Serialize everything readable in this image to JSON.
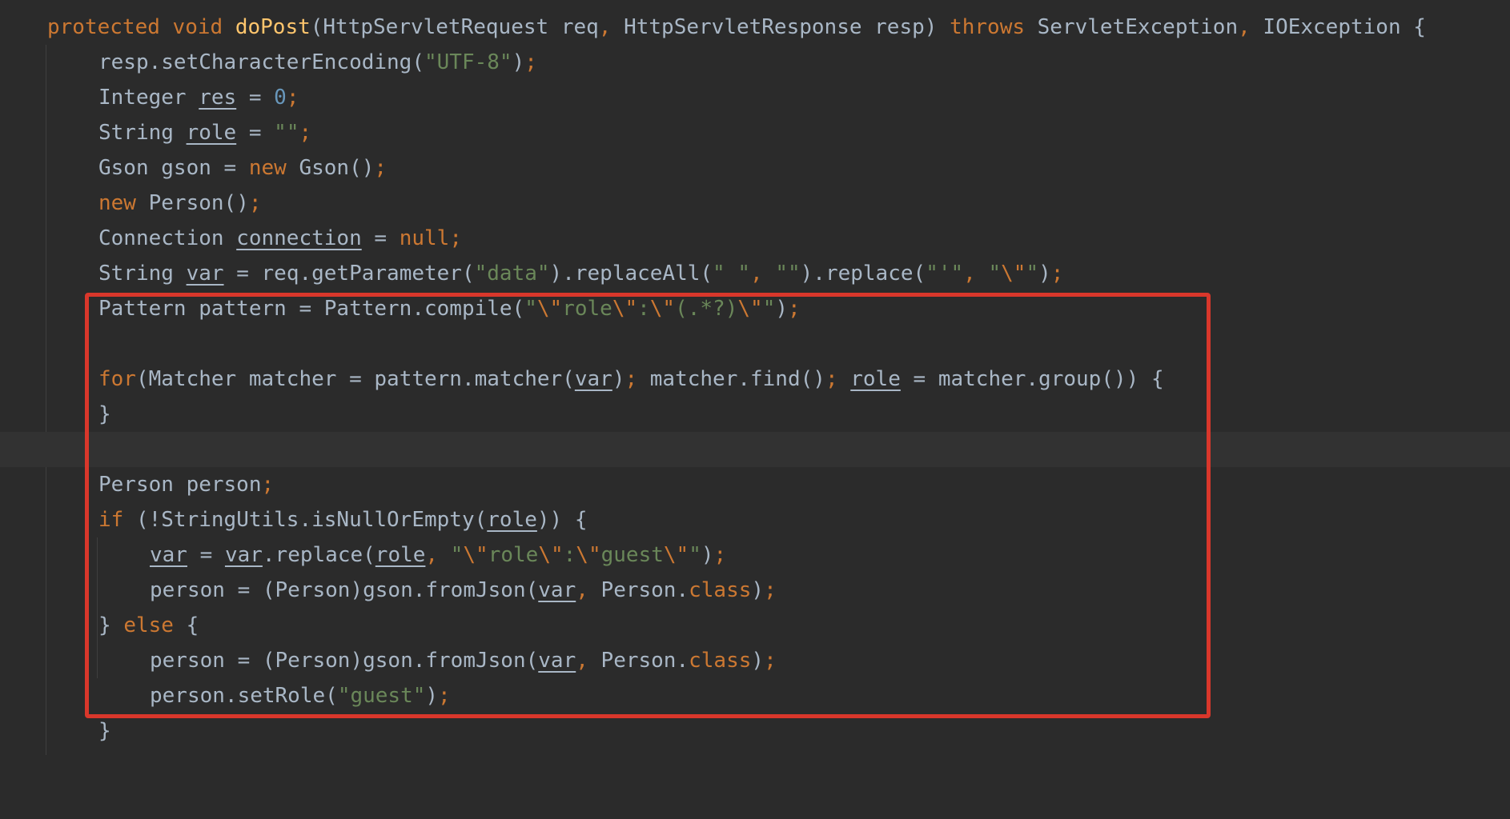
{
  "editor": {
    "language": "java",
    "accent_colors": {
      "keyword": "#cc7832",
      "method": "#ffc66d",
      "string": "#6a8759",
      "number": "#6897bb",
      "plain": "#a9b7c6",
      "highlight_border": "#d9372b",
      "background": "#2b2b2b"
    },
    "lines": {
      "l1": {
        "t1": "protected",
        "t2": " ",
        "t3": "void",
        "t4": " ",
        "t5": "doPost",
        "t6": "(HttpServletRequest req",
        "t7": ",",
        "t8": " HttpServletResponse resp) ",
        "t9": "throws",
        "t10": " ServletException",
        "t11": ",",
        "t12": " IOException {"
      },
      "l2": {
        "t1": "resp.setCharacterEncoding(",
        "t2": "\"UTF-8\"",
        "t3": ")",
        "t4": ";"
      },
      "l3": {
        "t1": "Integer ",
        "t2": "res",
        "t3": " = ",
        "t4": "0",
        "t5": ";"
      },
      "l4": {
        "t1": "String ",
        "t2": "role",
        "t3": " = ",
        "t4": "\"\"",
        "t5": ";"
      },
      "l5": {
        "t1": "Gson gson = ",
        "t2": "new",
        "t3": " Gson()",
        "t4": ";"
      },
      "l6": {
        "t1": "new",
        "t2": " Person()",
        "t3": ";"
      },
      "l7": {
        "t1": "Connection ",
        "t2": "connection",
        "t3": " = ",
        "t4": "null",
        "t5": ";"
      },
      "l8": {
        "t1": "String ",
        "t2": "var",
        "t3": " = req.getParameter(",
        "t4": "\"data\"",
        "t5": ").replaceAll(",
        "t6": "\" \"",
        "t7": ",",
        "t8": " ",
        "t9": "\"\"",
        "t10": ").replace(",
        "t11": "\"'\"",
        "t12": ",",
        "t13": " ",
        "t14": "\"",
        "t15": "\\\"",
        "t16": "\"",
        "t17": ")",
        "t18": ";"
      },
      "l9": {
        "t1": "Pattern pattern = Pattern.compile(",
        "t2": "\"",
        "t3": "\\\"",
        "t4": "role",
        "t5": "\\\"",
        "t6": ":",
        "t7": "\\\"",
        "t8": "(.*?)",
        "t9": "\\\"",
        "t10": "\"",
        "t11": ")",
        "t12": ";"
      },
      "l10": {
        "t1": ""
      },
      "l11": {
        "t1": "for",
        "t2": "(Matcher matcher = pattern.matcher(",
        "t3": "var",
        "t4": ")",
        "t5": ";",
        "t6": " matcher.find()",
        "t7": ";",
        "t8": " ",
        "t9": "role",
        "t10": " = matcher.group()) {"
      },
      "l12": {
        "t1": "}"
      },
      "l13": {
        "t1": ""
      },
      "l14": {
        "t1": "Person person",
        "t2": ";"
      },
      "l15": {
        "t1": "if",
        "t2": " (!StringUtils.isNullOrEmpty(",
        "t3": "role",
        "t4": ")) {"
      },
      "l16": {
        "t1": "var",
        "t2": " = ",
        "t3": "var",
        "t4": ".replace(",
        "t5": "role",
        "t6": ",",
        "t7": " ",
        "t8": "\"",
        "t9": "\\\"",
        "t10": "role",
        "t11": "\\\"",
        "t12": ":",
        "t13": "\\\"",
        "t14": "guest",
        "t15": "\\\"",
        "t16": "\"",
        "t17": ")",
        "t18": ";"
      },
      "l17": {
        "t1": "person = (Person)gson.fromJson(",
        "t2": "var",
        "t3": ",",
        "t4": " Person.",
        "t5": "class",
        "t6": ")",
        "t7": ";"
      },
      "l18": {
        "t1": "} ",
        "t2": "else",
        "t3": " {"
      },
      "l19": {
        "t1": "person = (Person)gson.fromJson(",
        "t2": "var",
        "t3": ",",
        "t4": " Person.",
        "t5": "class",
        "t6": ")",
        "t7": ";"
      },
      "l20": {
        "t1": "person.setRole(",
        "t2": "\"guest\"",
        "t3": ")",
        "t4": ";"
      },
      "l21": {
        "t1": "}"
      }
    }
  }
}
